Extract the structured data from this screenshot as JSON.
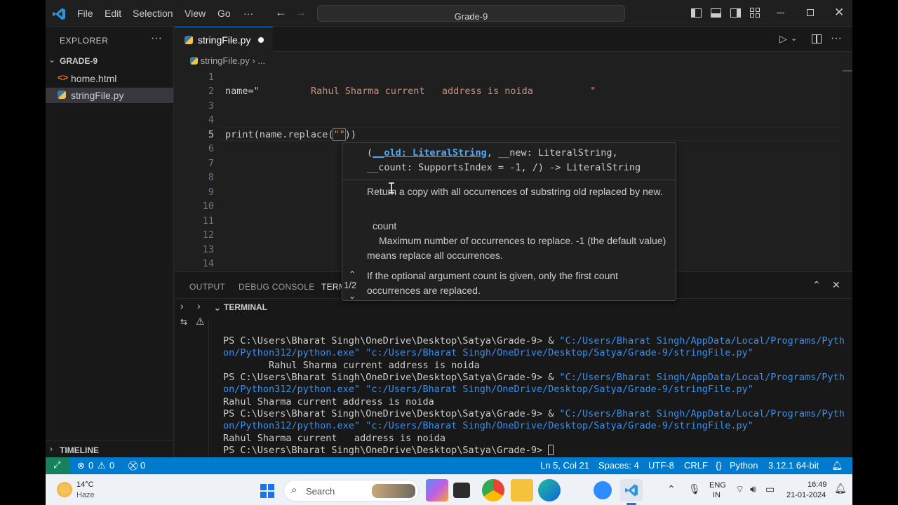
{
  "titlebar": {
    "menus": [
      "File",
      "Edit",
      "Selection",
      "View",
      "Go",
      "···"
    ],
    "search": "Grade-9"
  },
  "explorer": {
    "header": "EXPLORER",
    "folder": "GRADE-9",
    "files": [
      "home.html",
      "stringFile.py"
    ],
    "timeline": "TIMELINE"
  },
  "editor": {
    "tab": "stringFile.py",
    "breadcrumb_file": "stringFile.py",
    "breadcrumb_more": "...",
    "line_numbers": [
      "1",
      "2",
      "3",
      "4",
      "5",
      "6",
      "7",
      "8",
      "9",
      "10",
      "11",
      "12",
      "13",
      "14"
    ],
    "line2_var": "name=\"",
    "line2_str": "Rahul Sharma current   address is noida",
    "line2_end": "\"",
    "line5_print": "print(name.replace(",
    "line5_arg": "\"\"",
    "line5_close": "))"
  },
  "hover": {
    "sig_line1_a": "(",
    "sig_line1_b": "__old: LiteralString",
    "sig_line1_c": ", __new: LiteralString,",
    "sig_line2": "__count: SupportsIndex = -1, /) -> LiteralString",
    "doc1": "Return a copy with all occurrences of substring old replaced by new.",
    "param_name": "count",
    "param_desc": "Maximum number of occurrences to replace. -1 (the default value) means replace all occurrences.",
    "doc2": "If the optional argument count is given, only the first count occurrences are replaced.",
    "counter": "1/2"
  },
  "panel": {
    "tabs": [
      "OUTPUT",
      "DEBUG CONSOLE",
      "TERM"
    ],
    "terminal_header": "TERMINAL",
    "lines": [
      {
        "prompt": "PS C:\\Users\\Bharat Singh\\OneDrive\\Desktop\\Satya\\Grade-9> & ",
        "str": "\"C:/Users/Bharat Singh/AppData/Local/Programs/Pyth"
      },
      {
        "prompt": "",
        "str": "on/Python312/python.exe\" \"c:/Users/Bharat Singh/OneDrive/Desktop/Satya/Grade-9/stringFile.py\""
      },
      {
        "prompt": "        Rahul Sharma current address is noida",
        "str": ""
      },
      {
        "prompt": "PS C:\\Users\\Bharat Singh\\OneDrive\\Desktop\\Satya\\Grade-9> & ",
        "str": "\"C:/Users/Bharat Singh/AppData/Local/Programs/Pyth"
      },
      {
        "prompt": "",
        "str": "on/Python312/python.exe\" \"c:/Users/Bharat Singh/OneDrive/Desktop/Satya/Grade-9/stringFile.py\""
      },
      {
        "prompt": "Rahul Sharma current address is noida",
        "str": ""
      },
      {
        "prompt": "PS C:\\Users\\Bharat Singh\\OneDrive\\Desktop\\Satya\\Grade-9> & ",
        "str": "\"C:/Users/Bharat Singh/AppData/Local/Programs/Pyth"
      },
      {
        "prompt": "",
        "str": "on/Python312/python.exe\" \"c:/Users/Bharat Singh/OneDrive/Desktop/Satya/Grade-9/stringFile.py\""
      },
      {
        "prompt": "Rahul Sharma current   address is noida",
        "str": ""
      },
      {
        "prompt": "PS C:\\Users\\Bharat Singh\\OneDrive\\Desktop\\Satya\\Grade-9> ",
        "str": ""
      }
    ]
  },
  "statusbar": {
    "errors": "0",
    "warnings": "0",
    "ports": "0",
    "position": "Ln 5, Col 21",
    "spaces": "Spaces: 4",
    "encoding": "UTF-8",
    "eol": "CRLF",
    "language": "Python",
    "interpreter": "3.12.1 64-bit"
  },
  "taskbar": {
    "temp": "14°C",
    "weather": "Haze",
    "search": "Search",
    "lang1": "ENG",
    "lang2": "IN",
    "time": "16:49",
    "date": "21-01-2024"
  },
  "colors": {
    "accent": "#007acc",
    "keyword_string": "#ce9178",
    "terminal_string": "#3b8eea",
    "param_highlight": "#4daafc"
  }
}
